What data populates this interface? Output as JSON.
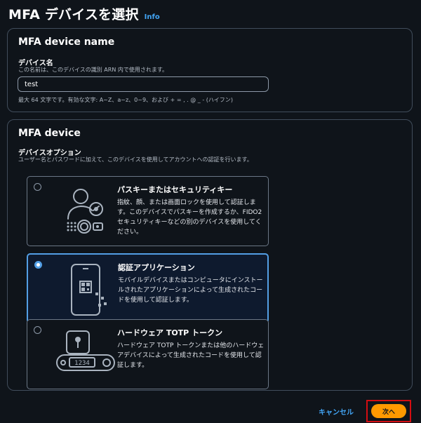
{
  "header": {
    "title": "MFA デバイスを選択",
    "info": "Info"
  },
  "device_name_section": {
    "title": "MFA device name",
    "field_label": "デバイス名",
    "field_description": "この名前は、このデバイスの識別 ARN 内で使用されます。",
    "input_value": "test",
    "hint": "最大 64 文字です。有効な文字: A~Z、a~z、0~9、および + = , . @ _ - (ハイフン)"
  },
  "device_section": {
    "title": "MFA device",
    "options_label": "デバイスオプション",
    "options_description": "ユーザー名とパスワードに加えて、このデバイスを使用してアカウントへの認証を行います。",
    "options": [
      {
        "title": "パスキーまたはセキュリティキー",
        "description": "指紋、顔、または画面ロックを使用して認証します。このデバイスでパスキーを作成するか、FIDO2 セキュリティキーなどの別のデバイスを使用してください。",
        "icon": "passkey-icon",
        "selected": false
      },
      {
        "title": "認証アプリケーション",
        "description": "モバイルデバイスまたはコンピュータにインストールされたアプリケーションによって生成されたコードを使用して認証します。",
        "icon": "authenticator-app-icon",
        "selected": true
      },
      {
        "title": "ハードウェア TOTP トークン",
        "description": "ハードウェア TOTP トークンまたは他のハードウェアデバイスによって生成されたコードを使用して認証します。",
        "icon": "hardware-token-icon",
        "token_code": "1234",
        "selected": false
      }
    ]
  },
  "footer": {
    "cancel_label": "キャンセル",
    "next_label": "次へ"
  },
  "colors": {
    "accent": "#539fe5",
    "primary_button": "#ff9900",
    "link": "#42a5f5",
    "highlight_box": "#d40d12"
  }
}
